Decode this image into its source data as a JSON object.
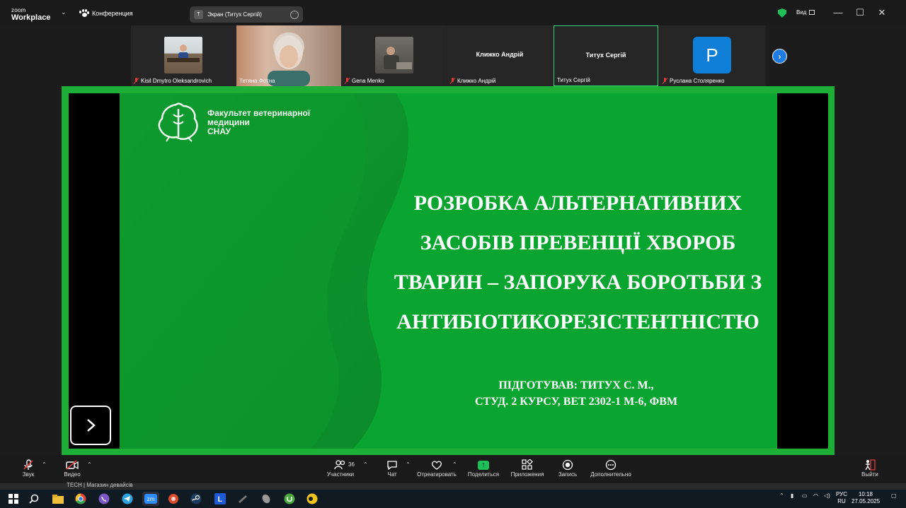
{
  "app": {
    "logo_line1": "zoom",
    "logo_line2": "Workplace",
    "meeting_label": "Конференция"
  },
  "screen_share_pill": {
    "avatar_letter": "T",
    "label": "Экран (Титух Сергій)",
    "more": "···"
  },
  "window": {
    "view_label": "Вид",
    "minimize": "—",
    "maximize": "☐",
    "close": "✕"
  },
  "participants": [
    {
      "name": "Kisil Dmytro Oleksandrovich",
      "muted": true,
      "kind": "photo"
    },
    {
      "name": "Тетяна Фотна",
      "muted": false,
      "kind": "photo-large"
    },
    {
      "name": "Gena Menko",
      "muted": true,
      "kind": "photo"
    },
    {
      "name": "Клижко Андрій",
      "muted": true,
      "kind": "name",
      "display": "Клижко Андрій"
    },
    {
      "name": "Титух Сергій",
      "muted": false,
      "kind": "name",
      "display": "Титух Сергій",
      "active": true
    },
    {
      "name": "Руслана Столяренко",
      "muted": true,
      "kind": "avatar",
      "avatar_letter": "P"
    }
  ],
  "slide": {
    "brand_lines": [
      "Факультет ветеринарної",
      "медицини",
      "СНАУ"
    ],
    "title_lines": [
      "РОЗРОБКА АЛЬТЕРНАТИВНИХ",
      "ЗАСОБІВ ПРЕВЕНЦІЇ ХВОРОБ",
      "ТВАРИН – ЗАПОРУКА БОРОТЬБИ З",
      "АНТИБІОТИКОРЕЗІСТЕНТНІСТЮ"
    ],
    "author_lines": [
      "ПІДГОТУВАВ: ТИТУХ С. М.,",
      "СТУД. 2 КУРСУ, ВЕТ 2302-1 М-6, ФВМ"
    ],
    "colors": {
      "green": "#0aa531",
      "frame": "#1dae35"
    }
  },
  "toolbar": {
    "audio": "Звук",
    "video": "Видео",
    "participants": "Участники",
    "participants_count": "36",
    "chat": "Чат",
    "react": "Отреагировать",
    "share": "Поделиться",
    "apps": "Приложения",
    "record": "Запись",
    "more": "Дополнительно",
    "leave": "Выйти"
  },
  "behind_window_text": "TECH | Магазин девайсів",
  "taskbar": {
    "lang_top": "РУС",
    "lang_bottom": "RU",
    "time": "10:18",
    "date": "27.05.2025"
  }
}
